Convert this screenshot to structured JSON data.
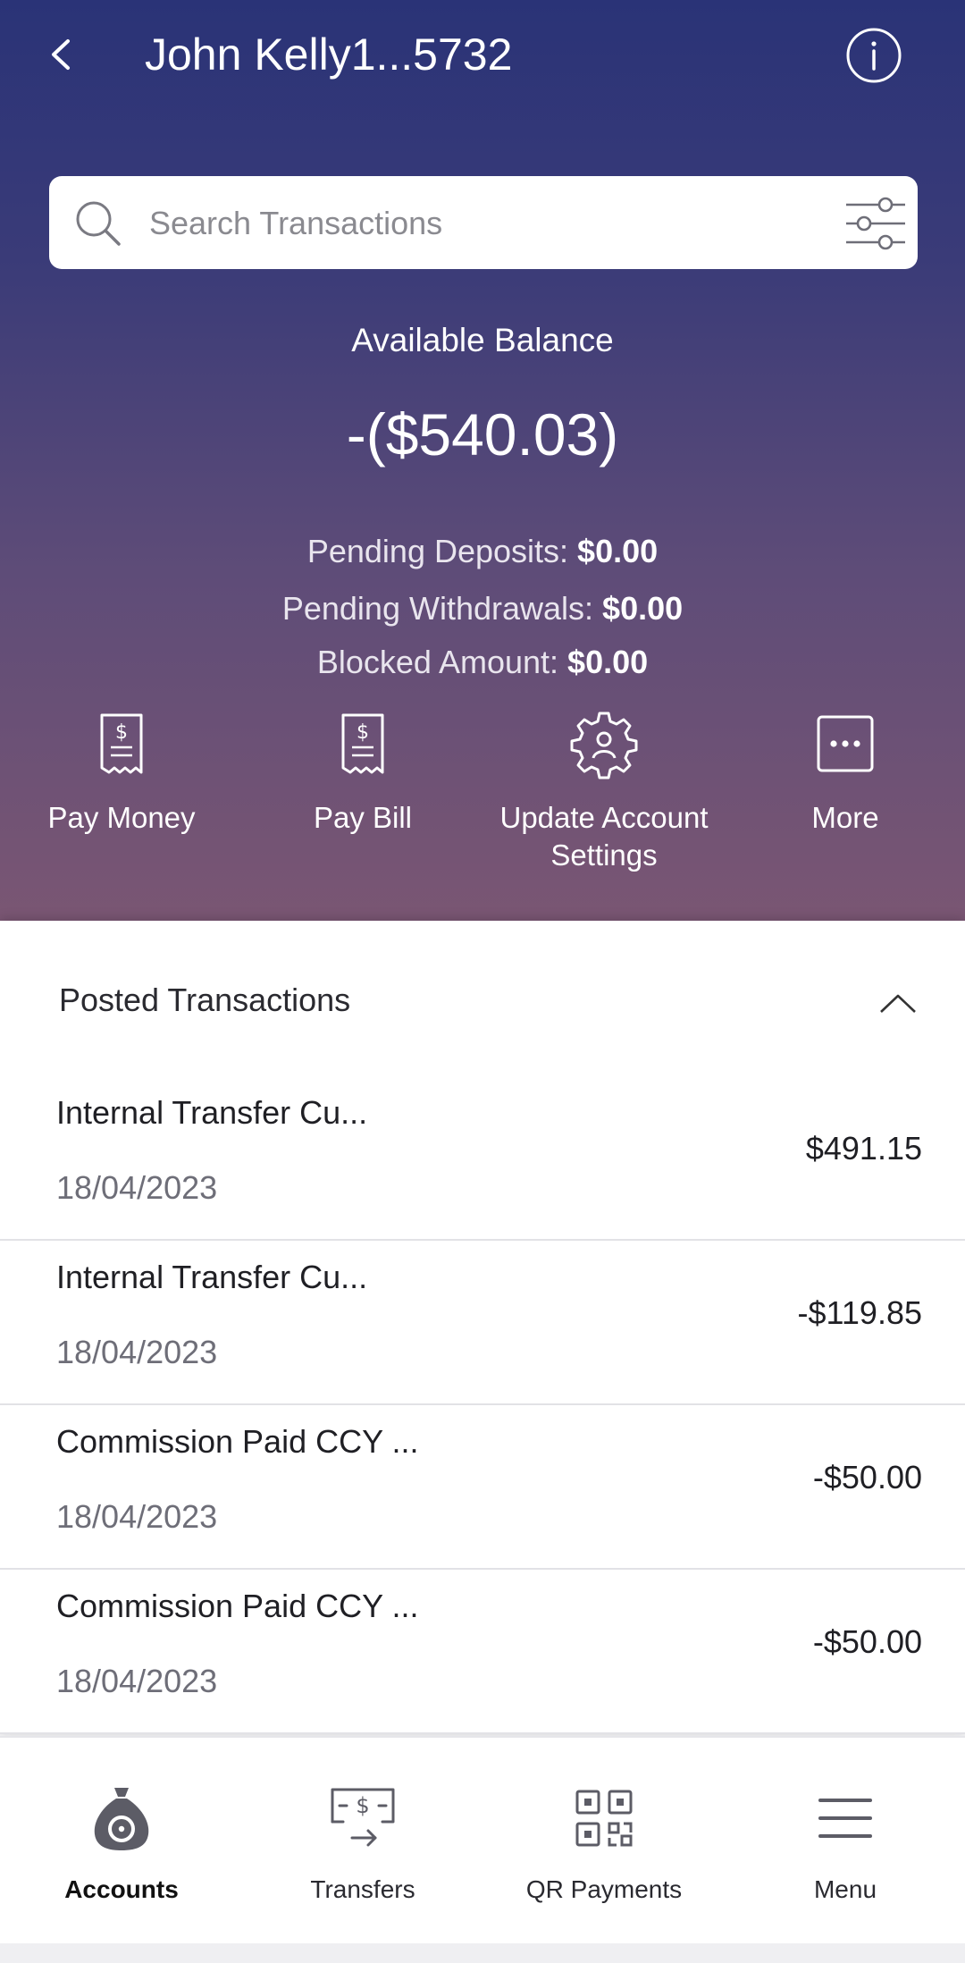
{
  "header": {
    "title": "John Kelly1...5732",
    "search_placeholder": "Search Transactions",
    "balance_label": "Available Balance",
    "balance_value": "-($540.03)",
    "pending_deposits_label": "Pending Deposits:",
    "pending_deposits_value": "$0.00",
    "pending_withdrawals_label": "Pending Withdrawals:",
    "pending_withdrawals_value": "$0.00",
    "blocked_amount_label": "Blocked Amount:",
    "blocked_amount_value": "$0.00"
  },
  "actions": [
    {
      "label": "Pay Money",
      "icon": "receipt-dollar-icon"
    },
    {
      "label": "Pay Bill",
      "icon": "receipt-dollar-icon"
    },
    {
      "label": "Update Account Settings",
      "icon": "gear-user-icon"
    },
    {
      "label": "More",
      "icon": "more-dots-icon"
    }
  ],
  "posted": {
    "title": "Posted Transactions",
    "transactions": [
      {
        "name": "Internal Transfer Cu...",
        "date": "18/04/2023",
        "amount": "$491.15"
      },
      {
        "name": "Internal Transfer Cu...",
        "date": "18/04/2023",
        "amount": "-$119.85"
      },
      {
        "name": "Commission Paid CCY ...",
        "date": "18/04/2023",
        "amount": "-$50.00"
      },
      {
        "name": "Commission Paid CCY ...",
        "date": "18/04/2023",
        "amount": "-$50.00"
      }
    ]
  },
  "nav": [
    {
      "label": "Accounts",
      "icon": "money-bag-icon",
      "active": true
    },
    {
      "label": "Transfers",
      "icon": "transfer-icon",
      "active": false
    },
    {
      "label": "QR Payments",
      "icon": "qr-code-icon",
      "active": false
    },
    {
      "label": "Menu",
      "icon": "hamburger-icon",
      "active": false
    }
  ],
  "colors": {
    "header_top": "#2a3377",
    "header_bottom": "#7a5673",
    "nav_icon": "#5c5c66"
  }
}
